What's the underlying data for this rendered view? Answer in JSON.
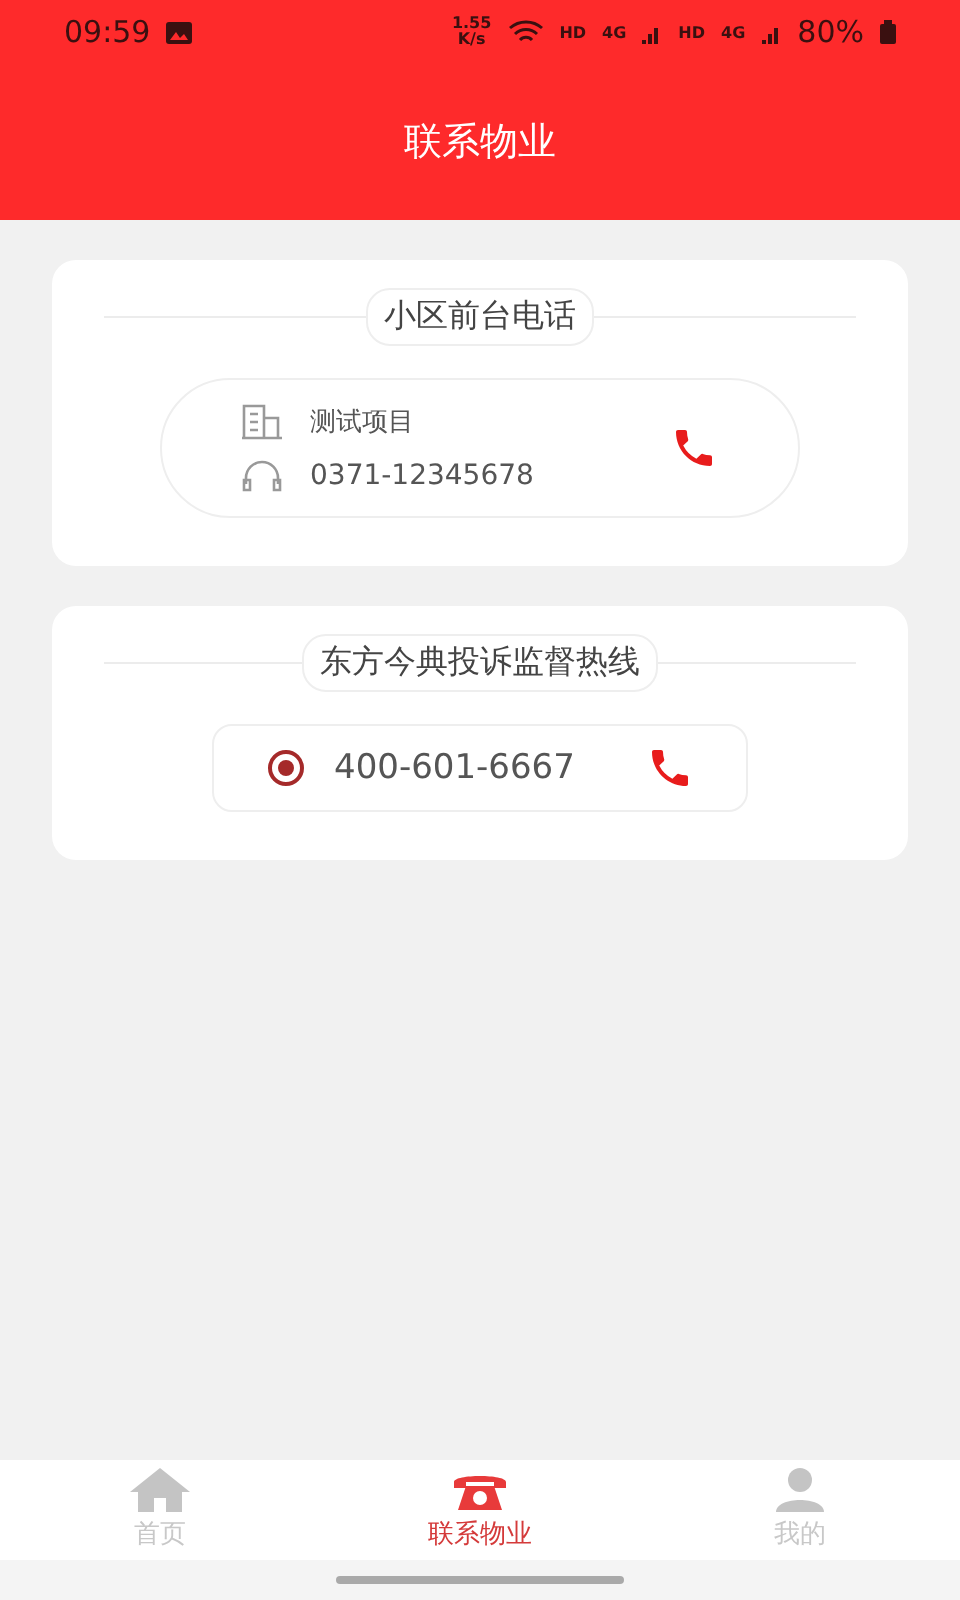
{
  "status_bar": {
    "time": "09:59",
    "speed": "1.55",
    "speed_unit": "K/s",
    "networks": [
      {
        "hd": "HD",
        "gen": "4G"
      },
      {
        "hd": "HD",
        "gen": "4G"
      }
    ],
    "battery": "80%"
  },
  "header": {
    "title": "联系物业"
  },
  "sections": [
    {
      "title": "小区前台电话",
      "kind": "detailed",
      "project": "测试项目",
      "phone": "0371-12345678"
    },
    {
      "title": "东方今典投诉监督热线",
      "kind": "simple",
      "phone": "400-601-6667"
    }
  ],
  "tabs": [
    {
      "label": "首页",
      "kind": "home",
      "selected": false
    },
    {
      "label": "联系物业",
      "kind": "phone",
      "selected": true
    },
    {
      "label": "我的",
      "kind": "person",
      "selected": false
    }
  ]
}
